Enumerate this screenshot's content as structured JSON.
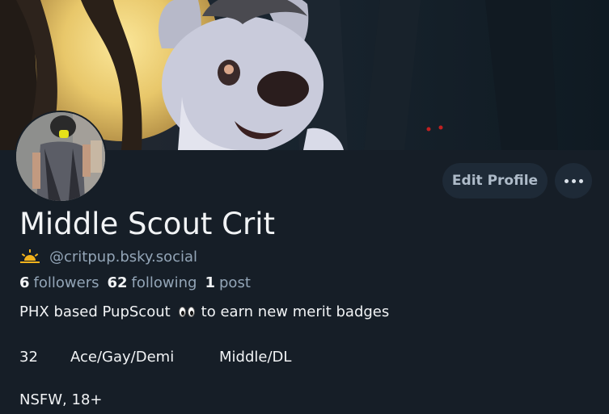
{
  "profile": {
    "display_name": "Middle Scout Crit",
    "handle": "@critpup.bsky.social",
    "handle_icon": "sunrise-emoji",
    "followers_count": "6",
    "followers_label": "followers",
    "following_count": "62",
    "following_label": "following",
    "posts_count": "1",
    "posts_label": "post",
    "bio": {
      "line1_before": "PHX based PupScout",
      "line1_emoji": "eyes-emoji",
      "line1_after": "to earn new merit badges",
      "line2": [
        "32",
        "Ace/Gay/Demi",
        "Middle/DL"
      ],
      "line3": "NSFW, 18+"
    }
  },
  "actions": {
    "edit_profile_label": "Edit Profile",
    "more_icon": "ellipsis-icon"
  },
  "colors": {
    "background": "#161e27",
    "button_bg": "#1e2a37",
    "muted_text": "#93a5b7",
    "primary_text": "#f1f3f5"
  }
}
